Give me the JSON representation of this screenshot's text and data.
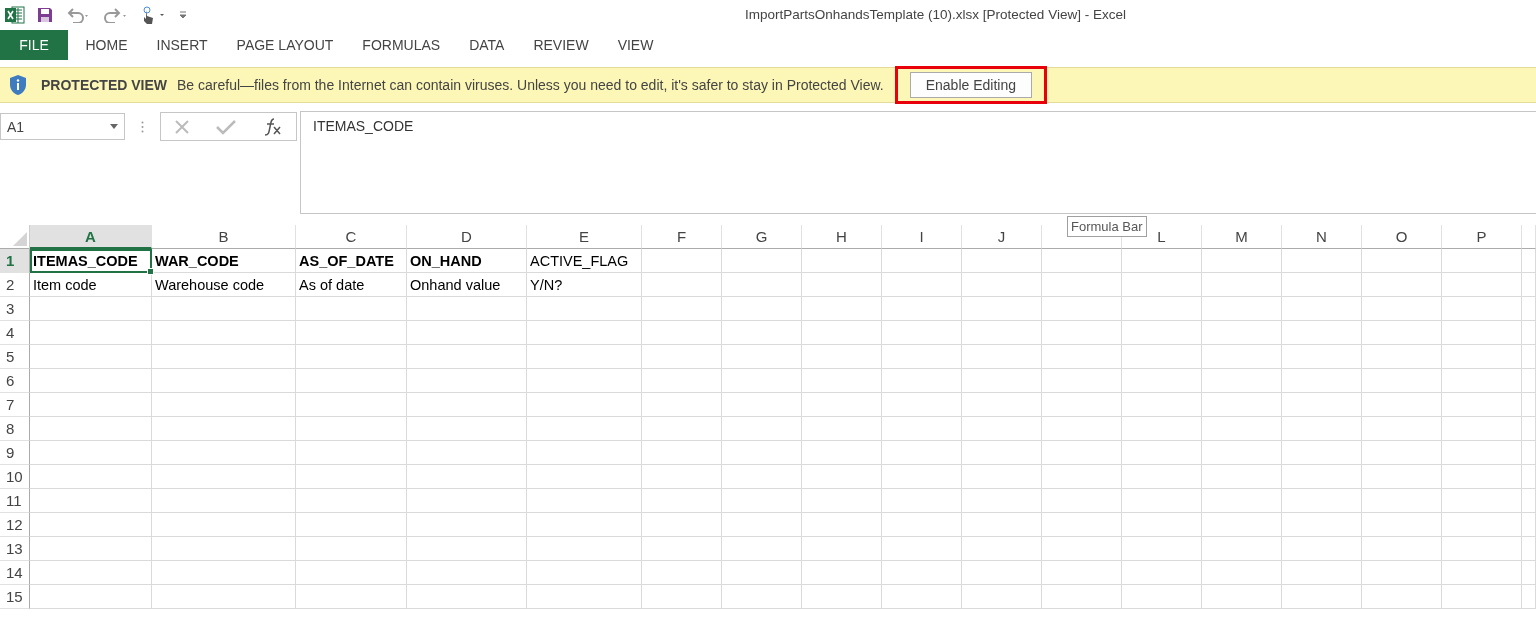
{
  "window": {
    "title": "ImportPartsOnhandsTemplate (10).xlsx  [Protected View] - Excel"
  },
  "ribbon_tabs": [
    {
      "label": "FILE",
      "kind": "file",
      "selected": false
    },
    {
      "label": "HOME",
      "kind": "tab",
      "selected": false
    },
    {
      "label": "INSERT",
      "kind": "tab",
      "selected": false
    },
    {
      "label": "PAGE LAYOUT",
      "kind": "tab",
      "selected": false
    },
    {
      "label": "FORMULAS",
      "kind": "tab",
      "selected": false
    },
    {
      "label": "DATA",
      "kind": "tab",
      "selected": false
    },
    {
      "label": "REVIEW",
      "kind": "tab",
      "selected": false
    },
    {
      "label": "VIEW",
      "kind": "tab",
      "selected": false
    }
  ],
  "message_bar": {
    "title": "PROTECTED VIEW",
    "message": "Be careful—files from the Internet can contain viruses. Unless you need to edit, it's safer to stay in Protected View.",
    "button": "Enable Editing",
    "highlighted": true
  },
  "name_box": {
    "value": "A1"
  },
  "formula_bar": {
    "value": "ITEMAS_CODE",
    "tooltip": "Formula Bar"
  },
  "columns": [
    {
      "label": "A",
      "selected": true
    },
    {
      "label": "B",
      "selected": false
    },
    {
      "label": "C",
      "selected": false
    },
    {
      "label": "D",
      "selected": false
    },
    {
      "label": "E",
      "selected": false
    },
    {
      "label": "F",
      "selected": false
    },
    {
      "label": "G",
      "selected": false
    },
    {
      "label": "H",
      "selected": false
    },
    {
      "label": "I",
      "selected": false
    },
    {
      "label": "J",
      "selected": false
    },
    {
      "selected": false
    },
    {
      "label": "L",
      "selected": false
    },
    {
      "label": "M",
      "selected": false
    },
    {
      "label": "N",
      "selected": false
    },
    {
      "label": "O",
      "selected": false
    },
    {
      "label": "P",
      "selected": false
    }
  ],
  "rows": [
    {
      "label": "1",
      "selected": true,
      "cells": [
        {
          "text": "ITEMAS_CODE",
          "bold": true,
          "selected": true
        },
        {
          "text": "WAR_CODE",
          "bold": true,
          "selected": false
        },
        {
          "text": "AS_OF_DATE",
          "bold": true,
          "selected": false
        },
        {
          "text": "ON_HAND",
          "bold": true,
          "selected": false
        },
        {
          "text": "ACTIVE_FLAG",
          "bold": false,
          "selected": false
        }
      ]
    },
    {
      "label": "2",
      "selected": false,
      "cells": [
        {
          "text": "Item code",
          "bold": false,
          "selected": false
        },
        {
          "text": "Warehouse code",
          "bold": false,
          "selected": false
        },
        {
          "text": "As of date",
          "bold": false,
          "selected": false
        },
        {
          "text": "Onhand value",
          "bold": false,
          "selected": false
        },
        {
          "text": "Y/N?",
          "bold": false,
          "selected": false
        }
      ]
    },
    {
      "label": "3",
      "selected": false,
      "cells": []
    },
    {
      "label": "4",
      "selected": false,
      "cells": []
    },
    {
      "label": "5",
      "selected": false,
      "cells": []
    },
    {
      "label": "6",
      "selected": false,
      "cells": []
    },
    {
      "label": "7",
      "selected": false,
      "cells": []
    },
    {
      "label": "8",
      "selected": false,
      "cells": []
    },
    {
      "label": "9",
      "selected": false,
      "cells": []
    },
    {
      "label": "10",
      "selected": false,
      "cells": []
    },
    {
      "label": "11",
      "selected": false,
      "cells": []
    },
    {
      "label": "12",
      "selected": false,
      "cells": []
    },
    {
      "label": "13",
      "selected": false,
      "cells": []
    },
    {
      "label": "14",
      "selected": false,
      "cells": []
    },
    {
      "label": "15",
      "selected": false,
      "cells": []
    }
  ]
}
